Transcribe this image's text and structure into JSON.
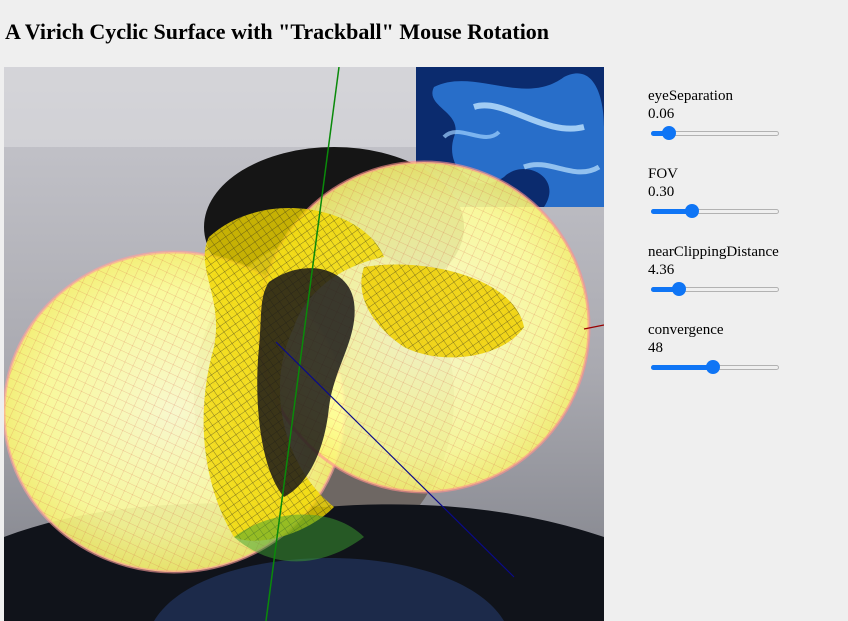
{
  "page": {
    "title": "A Virich Cyclic Surface with \"Trackball\" Mouse Rotation"
  },
  "controls": [
    {
      "label": "eyeSeparation",
      "value": "0.06",
      "fraction": 0.1
    },
    {
      "label": "FOV",
      "value": "0.30",
      "fraction": 0.3
    },
    {
      "label": "nearClippingDistance",
      "value": "4.36",
      "fraction": 0.18
    },
    {
      "label": "convergence",
      "value": "48",
      "fraction": 0.48
    }
  ],
  "colors": {
    "accent": "#0f75f5",
    "background": "#efefef",
    "surface": "#ffff66",
    "mesh": "#e04040",
    "axis_y": "#008000",
    "axis_z": "#00008b",
    "axis_x": "#8b0000"
  }
}
